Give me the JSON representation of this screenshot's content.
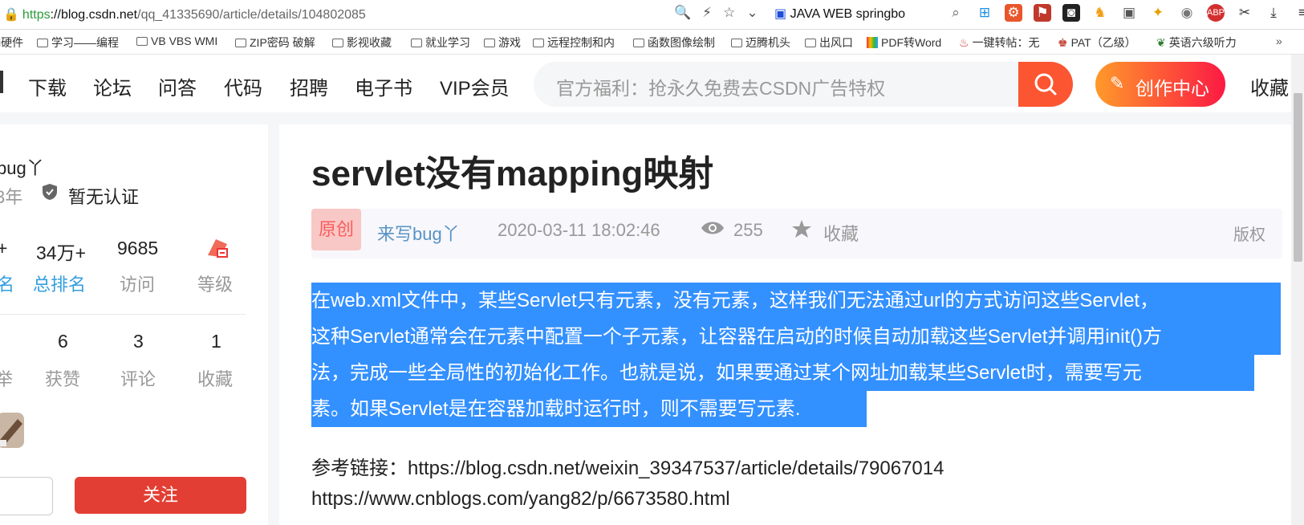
{
  "browser": {
    "url_proto": "https",
    "url_host": "://blog.csdn.net",
    "url_path": "/qq_41335690/article/details/104802085",
    "search_ext_text": "JAVA WEB springbo"
  },
  "bookmarks": [
    "i硬件",
    "学习——编程",
    "VB VBS WMI",
    "ZIP密码 破解",
    "影视收藏",
    "就业学习",
    "游戏",
    "远程控制和内",
    "函数图像绘制",
    "迈腾机头",
    "出风口",
    "PDF转Word",
    "一键转帖：无",
    "PAT（乙级）",
    "英语六级听力"
  ],
  "nav": {
    "items": [
      "下载",
      "论坛",
      "问答",
      "代码",
      "招聘",
      "电子书",
      "VIP会员"
    ],
    "search_placeholder": "官方福利：抢永久免费去CSDN广告特权",
    "create_label": "创作中心",
    "favorites": "收藏"
  },
  "sidebar": {
    "username": "bug丫",
    "years": "3年",
    "cert": "暂无认证",
    "stats1": {
      "v0": "+",
      "v1": "34万+",
      "v2": "9685",
      "l0": "名",
      "l1": "总排名",
      "l2": "访问",
      "l3": "等级"
    },
    "stats2": {
      "v1": "6",
      "v2": "3",
      "v3": "1",
      "l0": "举",
      "l1": "获赞",
      "l2": "评论",
      "l3": "收藏"
    },
    "follow": "关注"
  },
  "article": {
    "title": "servlet没有mapping映射",
    "tag": "原创",
    "author": "来写bug丫",
    "date": "2020-03-11 18:02:46",
    "views": "255",
    "fav": "收藏",
    "copyright": "版权",
    "lines": [
      "在web.xml文件中，某些Servlet只有元素，没有元素，这样我们无法通过url的方式访问这些Servlet，",
      "这种Servlet通常会在元素中配置一个子元素，让容器在启动的时候自动加载这些Servlet并调用init()方",
      "法，完成一些全局性的初始化工作。也就是说，如果要通过某个网址加载某些Servlet时，需要写元",
      "素。如果Servlet是在容器加载时运行时，则不需要写元素."
    ],
    "ref1": "参考链接：https://blog.csdn.net/weixin_39347537/article/details/79067014",
    "ref2": "https://www.cnblogs.com/yang82/p/6673580.html"
  }
}
